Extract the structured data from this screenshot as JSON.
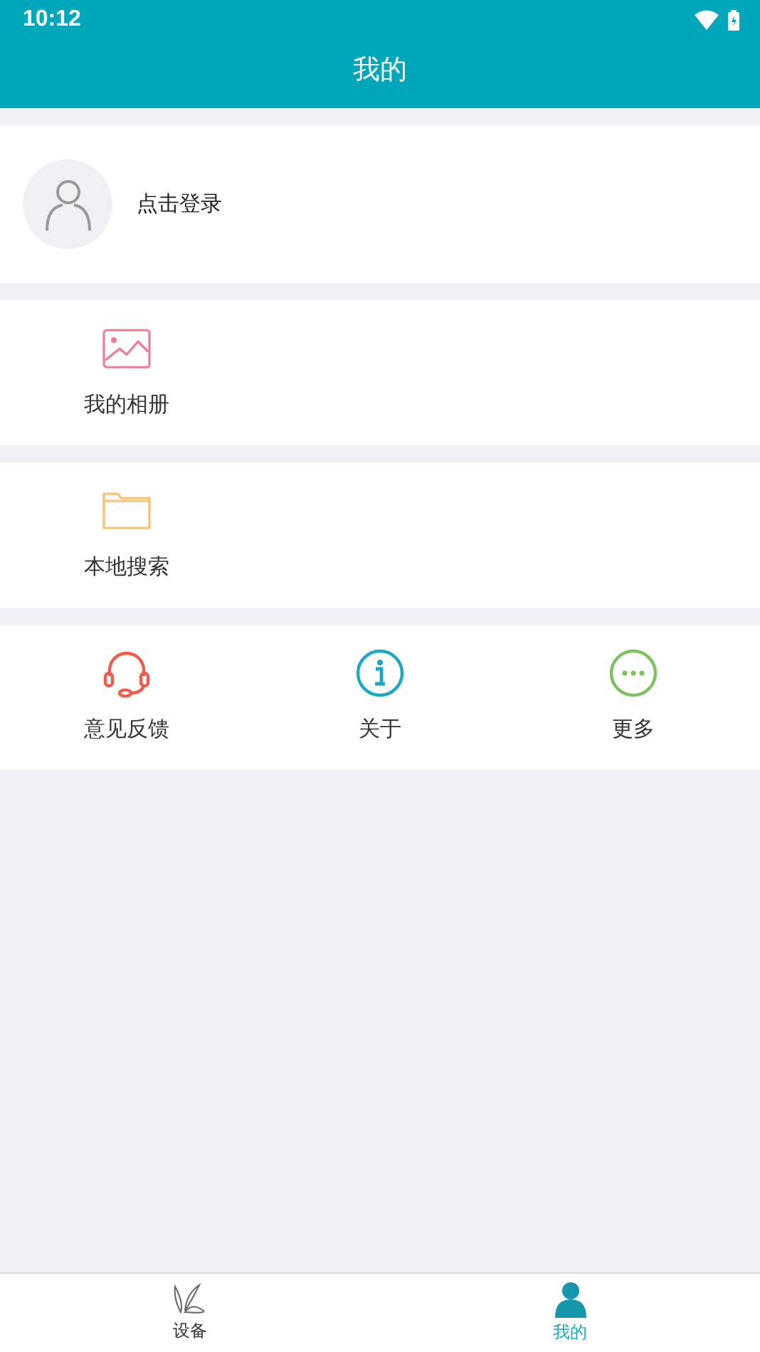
{
  "status_bar": {
    "time": "10:12"
  },
  "header": {
    "title": "我的"
  },
  "profile": {
    "login_label": "点击登录"
  },
  "sections": [
    {
      "items": [
        {
          "kind": "picture",
          "label": "我的相册",
          "color": "#f27a94"
        }
      ]
    },
    {
      "items": [
        {
          "kind": "folder",
          "label": "本地搜索",
          "color": "#f5c26b"
        }
      ]
    },
    {
      "items": [
        {
          "kind": "headset",
          "label": "意见反馈",
          "color": "#f45a4a"
        },
        {
          "kind": "info",
          "label": "关于",
          "color": "#1aa9c4"
        },
        {
          "kind": "more",
          "label": "更多",
          "color": "#7cc35f"
        }
      ]
    }
  ],
  "tab_bar": [
    {
      "kind": "device",
      "label": "设备",
      "selected": false
    },
    {
      "kind": "person",
      "label": "我的",
      "selected": true
    }
  ]
}
